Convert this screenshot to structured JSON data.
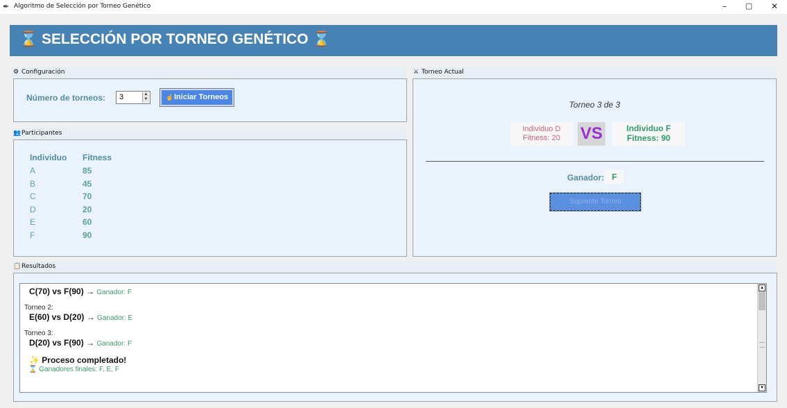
{
  "window": {
    "title": "Algoritmo de Selección por Torneo Genético",
    "icon": "feather-icon",
    "controls": {
      "minimize": "–",
      "maximize": "▢",
      "close": "✕"
    }
  },
  "header": {
    "title": "⌛ SELECCIÓN POR TORNEO GENÉTICO ⌛",
    "bg_color": "#4682b4"
  },
  "config": {
    "section_label": "Configuración",
    "section_icon": "gear-icon",
    "tournaments_label": "Número de torneos:",
    "tournaments_value": "3",
    "start_button": "Iniciar Torneos",
    "start_button_icon": "hand-icon"
  },
  "participants": {
    "section_label": "Participantes",
    "section_icon": "people-icon",
    "headers": [
      "Individuo",
      "Fitness"
    ],
    "rows": [
      {
        "name": "A",
        "fitness": "85"
      },
      {
        "name": "B",
        "fitness": "45"
      },
      {
        "name": "C",
        "fitness": "70"
      },
      {
        "name": "D",
        "fitness": "20"
      },
      {
        "name": "E",
        "fitness": "60"
      },
      {
        "name": "F",
        "fitness": "90"
      }
    ]
  },
  "current": {
    "section_label": "Torneo Actual",
    "section_icon": "crossed-swords-icon",
    "round_text": "Torneo 3 de 3",
    "fighter_a": {
      "name": "Individuo D",
      "fitness": "Fitness: 20"
    },
    "vs": "VS",
    "fighter_b": {
      "name": "Individuo F",
      "fitness": "Fitness: 90"
    },
    "winner_label": "Ganador:",
    "winner_value": "F",
    "next_button": "Siguiente Torneo"
  },
  "results": {
    "section_label": "Resultados",
    "section_icon": "clipboard-icon",
    "lines": {
      "match1": "C(70) vs F(90) → ",
      "match1_win": "Ganador: F",
      "t2_label": "Torneo 2:",
      "match2": "E(60) vs D(20) → ",
      "match2_win": "Ganador: E",
      "t3_label": "Torneo 3:",
      "match3": "D(20) vs F(90) → ",
      "match3_win": "Ganador: F",
      "done": "✨ Proceso completado!",
      "finals": "⌛ Ganadores finales: F, E, F"
    }
  }
}
